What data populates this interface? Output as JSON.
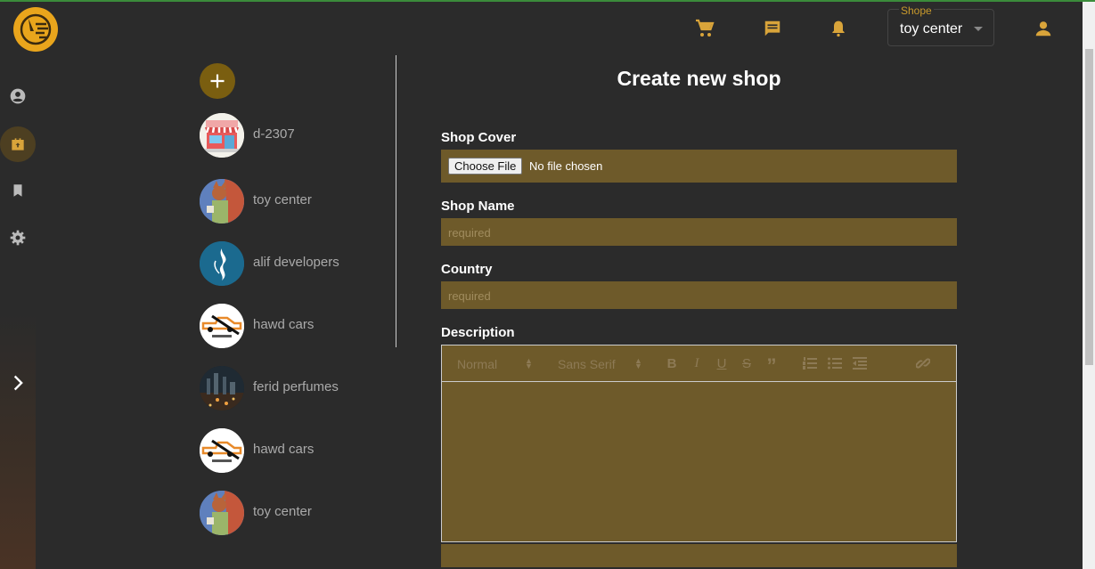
{
  "header": {
    "shope_select": {
      "label": "Shope",
      "value": "toy center"
    }
  },
  "sidebar": {
    "icons": [
      "account-circle-icon",
      "store-icon",
      "bookmark-icon",
      "settings-icon",
      "chevron-right-icon"
    ]
  },
  "shops": {
    "items": [
      {
        "name": "d-2307",
        "avatar": "store-front"
      },
      {
        "name": "toy center",
        "avatar": "toy-figure"
      },
      {
        "name": "alif developers",
        "avatar": "alif-logo"
      },
      {
        "name": "hawd cars",
        "avatar": "car-logo"
      },
      {
        "name": "ferid perfumes",
        "avatar": "city-night"
      },
      {
        "name": "hawd cars",
        "avatar": "car-logo"
      },
      {
        "name": "toy center",
        "avatar": "toy-figure"
      }
    ]
  },
  "form": {
    "title": "Create new shop",
    "cover_label": "Shop Cover",
    "choose_file": "Choose File",
    "no_file": "No file chosen",
    "name_label": "Shop Name",
    "name_placeholder": "required",
    "country_label": "Country",
    "country_placeholder": "required",
    "description_label": "Description",
    "editor": {
      "header_select": "Normal",
      "font_select": "Sans Serif",
      "bold": "B",
      "italic": "I",
      "underline": "U",
      "strike": "S",
      "quote": "”"
    }
  },
  "colors": {
    "accent": "#e9a51c",
    "field_bg": "#6e5a2a",
    "page_bg": "#2b2b2b"
  }
}
